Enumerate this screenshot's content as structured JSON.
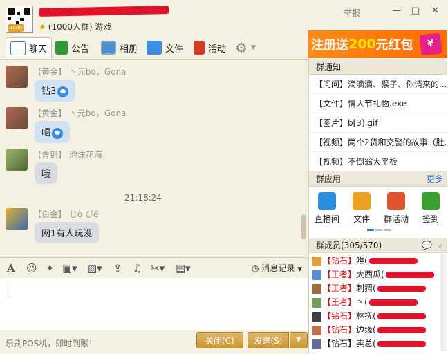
{
  "window": {
    "group_name": "",
    "subtitle_members": "(1000人群)",
    "subtitle_category": "游戏",
    "report_label": "举报",
    "minimize_label": "—",
    "maximize_label": "□",
    "close_label": "✕"
  },
  "tabs": [
    {
      "label": "聊天",
      "icon": "chat-icon"
    },
    {
      "label": "公告",
      "icon": "flag-icon"
    },
    {
      "label": "相册",
      "icon": "photo-icon"
    },
    {
      "label": "文件",
      "icon": "folder-icon"
    },
    {
      "label": "活动",
      "icon": "activity-flag-icon"
    }
  ],
  "banner": {
    "pre": "注册送",
    "amount": "200",
    "post": "元红包",
    "envelope": "¥"
  },
  "messages": [
    {
      "rank": "【黄金】",
      "name": "丶元bo，Gona",
      "text": "钻3"
    },
    {
      "rank": "【黄金】",
      "name": "丶元bo，Gona",
      "text": "喝"
    },
    {
      "rank": "【青铜】",
      "name": "泡沫花海",
      "text": "哦"
    },
    {
      "rank": "【白金】",
      "name": "じò ぴé",
      "text": "网1有人玩没"
    }
  ],
  "timestamp": "21:18:24",
  "input_toolbar": {
    "history_label": "消息记录"
  },
  "footer": {
    "ad_text": "乐刷POS机，即时到账！",
    "close_label": "关闭(C)",
    "send_label": "发送(S)"
  },
  "notices_section": {
    "title": "群通知",
    "items": [
      "【问问】滴滴滴、猴子、你请来的...",
      "【文件】情人节礼物.exe",
      "【图片】b[3].gif",
      "【视频】两个2货和交警的故事（肚...",
      "【视频】不倒翁大平板"
    ]
  },
  "apps_section": {
    "title": "群应用",
    "more_label": "更多",
    "apps": [
      {
        "label": "直播间",
        "color": "#2a8ee0"
      },
      {
        "label": "文件",
        "color": "#f0a020"
      },
      {
        "label": "群活动",
        "color": "#e05530"
      },
      {
        "label": "签到",
        "color": "#3aa030"
      }
    ]
  },
  "members_section": {
    "title": "群成员(305/570)",
    "members": [
      {
        "rank": "【钻石】",
        "name": "唯("
      },
      {
        "rank": "【王者】",
        "name": "大西瓜("
      },
      {
        "rank": "【王者】",
        "name": "刺猬("
      },
      {
        "rank": "【王者】",
        "name": "丶("
      },
      {
        "rank": "【钻石】",
        "name": "林抚("
      },
      {
        "rank": "【钻石】",
        "name": "边缘("
      },
      {
        "rank": "【钻石】",
        "name": "卖总("
      }
    ]
  }
}
